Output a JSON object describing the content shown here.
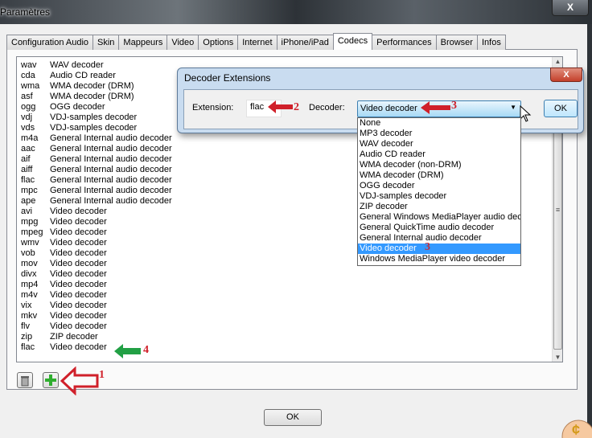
{
  "window": {
    "title": "Paramètres",
    "close": "X"
  },
  "tabs": [
    "Configuration Audio",
    "Skin",
    "Mappeurs",
    "Video",
    "Options",
    "Internet",
    "iPhone/iPad",
    "Codecs",
    "Performances",
    "Browser",
    "Infos"
  ],
  "active_tab": "Codecs",
  "codecs": [
    [
      "wav",
      "WAV decoder"
    ],
    [
      "cda",
      "Audio CD reader"
    ],
    [
      "wma",
      "WMA decoder (DRM)"
    ],
    [
      "asf",
      "WMA decoder (DRM)"
    ],
    [
      "ogg",
      "OGG decoder"
    ],
    [
      "vdj",
      "VDJ-samples decoder"
    ],
    [
      "vds",
      "VDJ-samples decoder"
    ],
    [
      "m4a",
      "General Internal audio decoder"
    ],
    [
      "aac",
      "General Internal audio decoder"
    ],
    [
      "aif",
      "General Internal audio decoder"
    ],
    [
      "aiff",
      "General Internal audio decoder"
    ],
    [
      "flac",
      "General Internal audio decoder"
    ],
    [
      "mpc",
      "General Internal audio decoder"
    ],
    [
      "ape",
      "General Internal audio decoder"
    ],
    [
      "avi",
      "Video decoder"
    ],
    [
      "mpg",
      "Video decoder"
    ],
    [
      "mpeg",
      "Video decoder"
    ],
    [
      "wmv",
      "Video decoder"
    ],
    [
      "vob",
      "Video decoder"
    ],
    [
      "mov",
      "Video decoder"
    ],
    [
      "divx",
      "Video decoder"
    ],
    [
      "mp4",
      "Video decoder"
    ],
    [
      "m4v",
      "Video decoder"
    ],
    [
      "vix",
      "Video decoder"
    ],
    [
      "mkv",
      "Video decoder"
    ],
    [
      "flv",
      "Video decoder"
    ],
    [
      "zip",
      "ZIP decoder"
    ],
    [
      "flac",
      "Video decoder"
    ]
  ],
  "ok_label": "OK",
  "dialog": {
    "title": "Decoder Extensions",
    "close": "X",
    "extension_label": "Extension:",
    "extension_value": "flac",
    "decoder_label": "Decoder:",
    "decoder_value": "Video decoder",
    "ok_label": "OK",
    "options": [
      "None",
      "MP3 decoder",
      "WAV decoder",
      "Audio CD reader",
      "WMA decoder (non-DRM)",
      "WMA decoder (DRM)",
      "OGG decoder",
      "VDJ-samples decoder",
      "ZIP decoder",
      "General Windows MediaPlayer audio decoder",
      "General QuickTime audio decoder",
      "General Internal audio decoder",
      "Video decoder",
      "Windows MediaPlayer video decoder"
    ],
    "selected_index": 12
  },
  "annotations": {
    "a1": "1",
    "a2": "2",
    "a3": "3",
    "a3b": "3",
    "a4": "4",
    "red": "#d0202a",
    "green": "#22a045"
  }
}
